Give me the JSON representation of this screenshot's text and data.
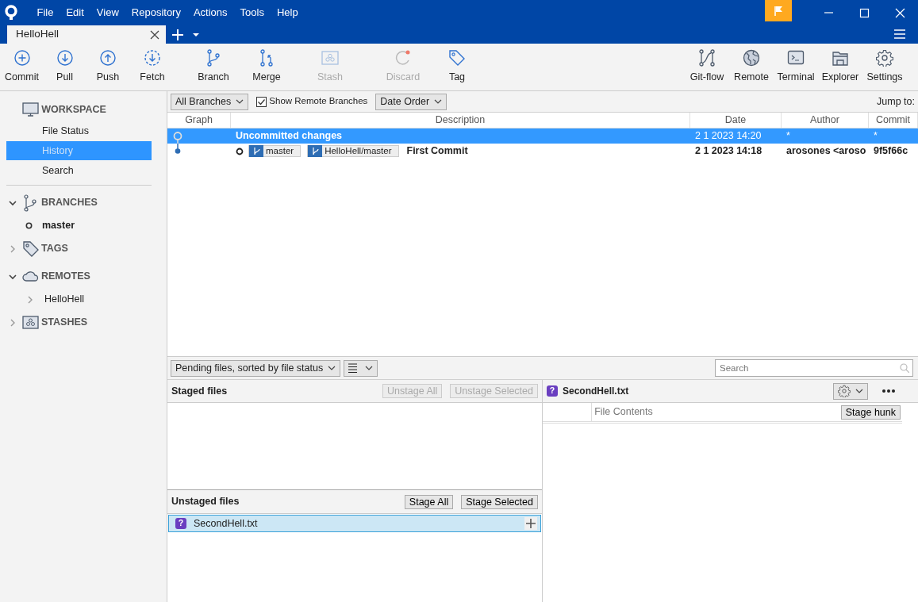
{
  "window": {
    "menu": [
      "File",
      "Edit",
      "View",
      "Repository",
      "Actions",
      "Tools",
      "Help"
    ]
  },
  "tabs": [
    {
      "label": "HelloHell",
      "selected": true
    }
  ],
  "toolbar": {
    "left": [
      {
        "label": "Commit",
        "disabled": false
      },
      {
        "label": "Pull",
        "disabled": false
      },
      {
        "label": "Push",
        "disabled": false
      },
      {
        "label": "Fetch",
        "disabled": false
      },
      {
        "label": "Branch",
        "disabled": false
      },
      {
        "label": "Merge",
        "disabled": false
      },
      {
        "label": "Stash",
        "disabled": true
      },
      {
        "label": "Discard",
        "disabled": true
      },
      {
        "label": "Tag",
        "disabled": false
      }
    ],
    "right": [
      {
        "label": "Git-flow"
      },
      {
        "label": "Remote"
      },
      {
        "label": "Terminal"
      },
      {
        "label": "Explorer"
      },
      {
        "label": "Settings"
      }
    ]
  },
  "sidebar": {
    "workspace": {
      "title": "WORKSPACE",
      "items": [
        {
          "label": "File Status",
          "selected": false
        },
        {
          "label": "History",
          "selected": true
        },
        {
          "label": "Search",
          "selected": false
        }
      ]
    },
    "sections": [
      {
        "title": "BRANCHES",
        "expanded": true,
        "items": [
          {
            "label": "master",
            "current": true
          }
        ]
      },
      {
        "title": "TAGS",
        "expanded": false
      },
      {
        "title": "REMOTES",
        "expanded": true,
        "items": [
          {
            "label": "HelloHell",
            "expanded": false
          }
        ]
      },
      {
        "title": "STASHES",
        "expanded": false
      }
    ]
  },
  "history": {
    "branch_filter": "All Branches",
    "show_remote": {
      "label": "Show Remote Branches",
      "checked": true
    },
    "order": "Date Order",
    "jump_label": "Jump to:",
    "columns": [
      "Graph",
      "Description",
      "Date",
      "Author",
      "Commit"
    ],
    "rows": [
      {
        "kind": "uncommitted",
        "selected": true,
        "description": "Uncommitted changes",
        "date": "2 1 2023 14:20",
        "author": "*",
        "commit": "*"
      },
      {
        "kind": "commit",
        "selected": false,
        "refs": [
          "master",
          "HelloHell/master"
        ],
        "description": "First Commit",
        "date": "2 1 2023 14:18",
        "author": "arosones <aroso",
        "commit": "9f5f66c"
      }
    ]
  },
  "pending": {
    "sort": "Pending files, sorted by file status",
    "search": {
      "placeholder": "Search"
    },
    "staged": {
      "title": "Staged files",
      "buttons": [
        {
          "label": "Unstage All",
          "disabled": true
        },
        {
          "label": "Unstage Selected",
          "disabled": true
        }
      ]
    },
    "unstaged": {
      "title": "Unstaged files",
      "buttons": [
        {
          "label": "Stage All",
          "disabled": false
        },
        {
          "label": "Stage Selected",
          "disabled": false
        }
      ],
      "files": [
        {
          "status": "?",
          "name": "SecondHell.txt",
          "selected": true
        }
      ]
    },
    "diff": {
      "status": "?",
      "file": "SecondHell.txt",
      "column": "File Contents",
      "hunk_button": "Stage hunk"
    }
  }
}
